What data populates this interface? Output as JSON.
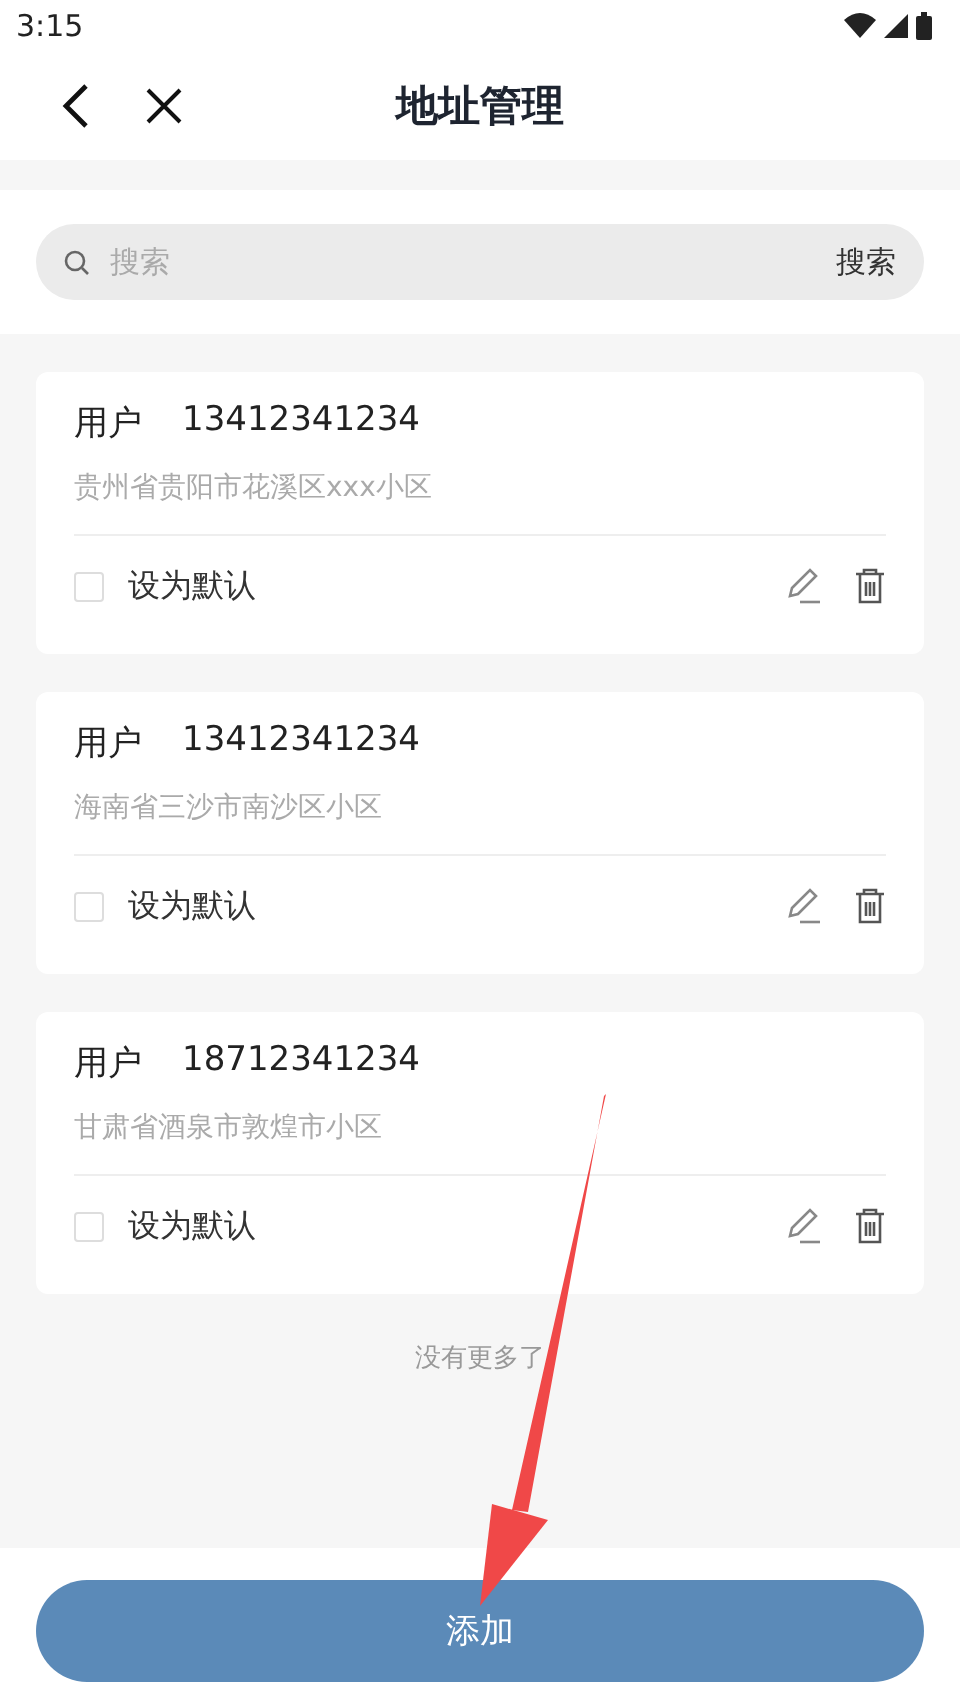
{
  "status_bar": {
    "time": "3:15"
  },
  "header": {
    "title": "地址管理"
  },
  "search": {
    "placeholder": "搜索",
    "button": "搜索"
  },
  "addresses": [
    {
      "name": "用户",
      "phone": "13412341234",
      "address": "贵州省贵阳市花溪区xxx小区",
      "default_label": "设为默认",
      "checked": false
    },
    {
      "name": "用户",
      "phone": "13412341234",
      "address": "海南省三沙市南沙区小区",
      "default_label": "设为默认",
      "checked": false
    },
    {
      "name": "用户",
      "phone": "18712341234",
      "address": "甘肃省酒泉市敦煌市小区",
      "default_label": "设为默认",
      "checked": false
    }
  ],
  "end_note": "没有更多了",
  "add_button": "添加"
}
